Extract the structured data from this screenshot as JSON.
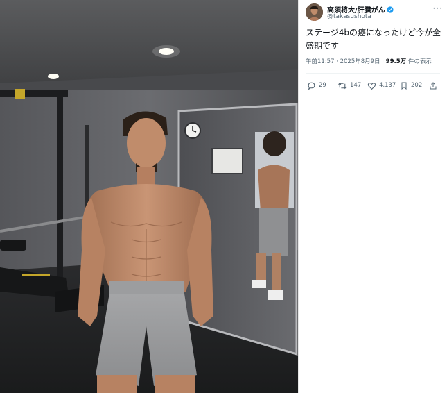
{
  "post": {
    "display_name": "高須将大/肝臓がん",
    "handle": "@takasushota",
    "text": "ステージ4bの癌になったけど今が全盛期です",
    "time": "午前11:57",
    "date": "2025年8月9日",
    "views_count": "99.5万",
    "views_label": "件の表示",
    "more_label": "···"
  },
  "actions": {
    "replies": "29",
    "reposts": "147",
    "likes": "4,137",
    "bookmarks": "202"
  },
  "colors": {
    "verified": "#1d9bf0",
    "text": "#0f1419",
    "muted": "#536471"
  },
  "icons": [
    "verified-badge-icon",
    "reply-icon",
    "repost-icon",
    "like-icon",
    "bookmark-icon",
    "share-icon",
    "more-icon"
  ]
}
